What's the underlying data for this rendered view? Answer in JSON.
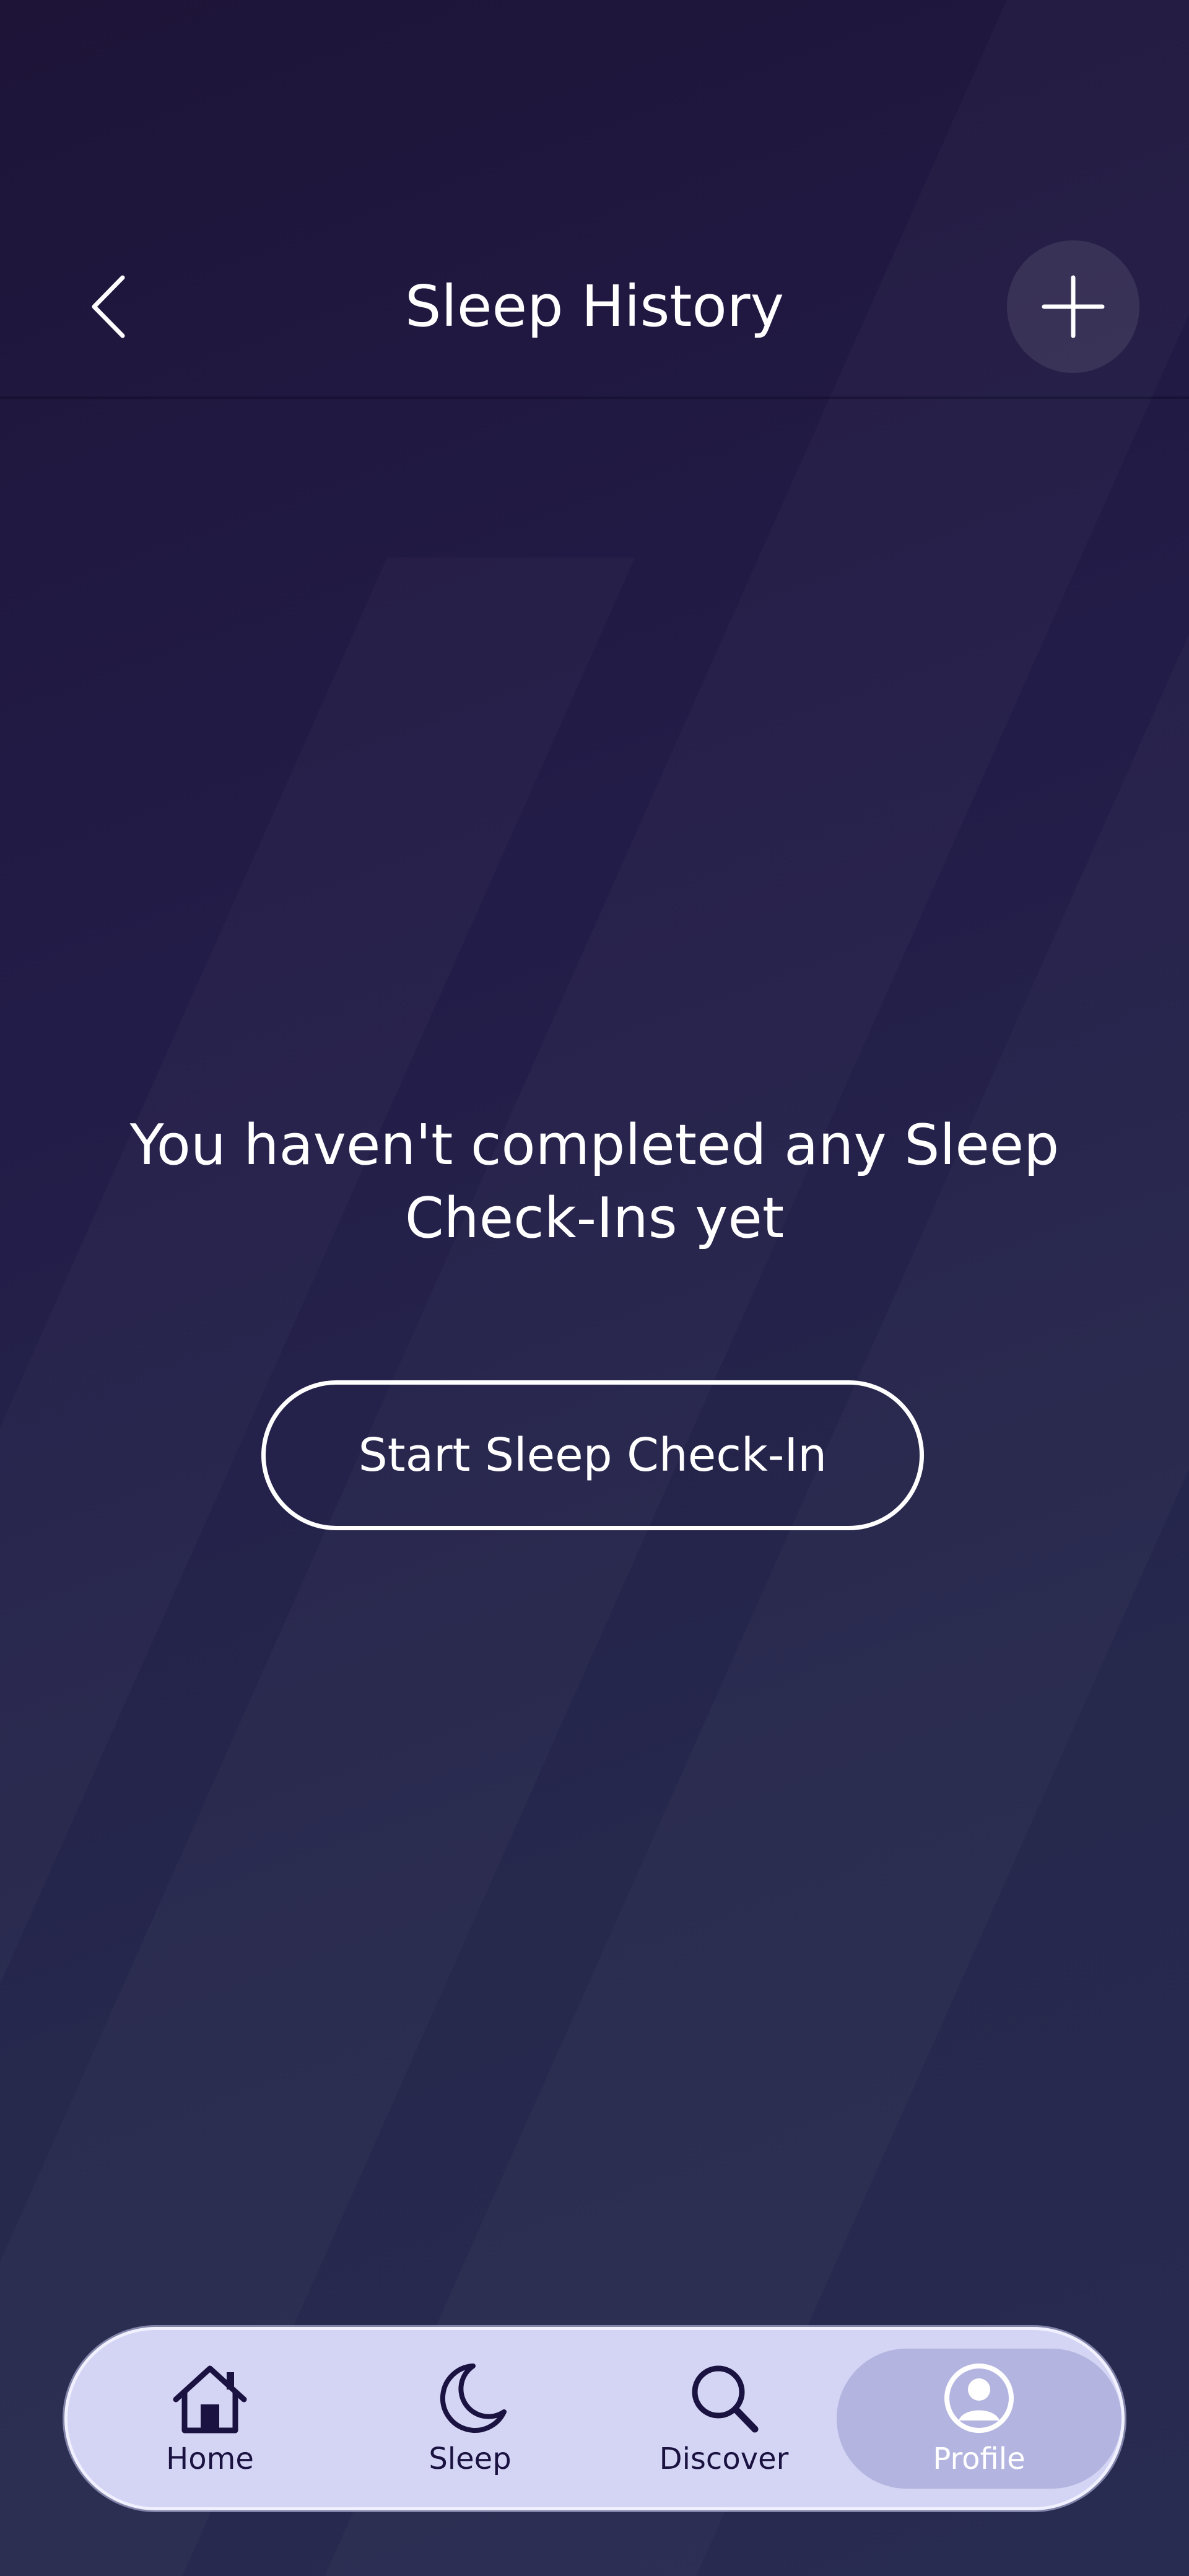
{
  "header": {
    "title": "Sleep History",
    "back_icon": "chevron-left-icon",
    "add_icon": "plus-icon"
  },
  "main": {
    "empty_message": "You haven't completed any Sleep Check-Ins yet",
    "start_button_label": "Start Sleep Check-In"
  },
  "nav": {
    "items": [
      {
        "label": "Home",
        "icon": "home-icon",
        "active": false
      },
      {
        "label": "Sleep",
        "icon": "moon-icon",
        "active": false
      },
      {
        "label": "Discover",
        "icon": "search-icon",
        "active": false
      },
      {
        "label": "Profile",
        "icon": "profile-icon",
        "active": true
      }
    ]
  },
  "colors": {
    "background": "#221c48",
    "nav_background": "#d4d4f4",
    "nav_active": "#b3b5e0",
    "nav_text": "#1a1240",
    "text": "#ffffff"
  }
}
